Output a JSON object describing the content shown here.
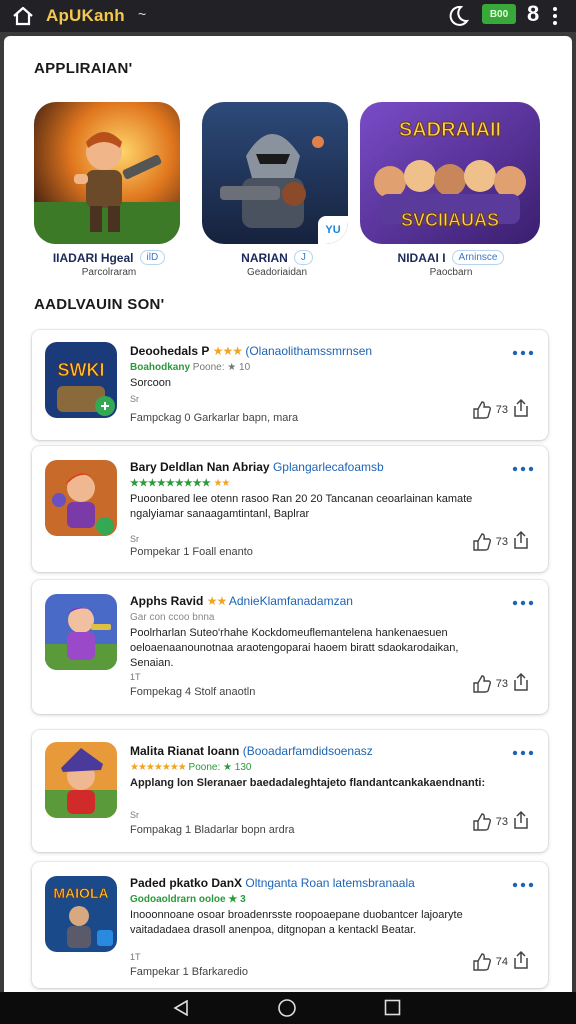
{
  "topbar": {
    "title": "ApUKanh",
    "title_suffix": "~",
    "battery_label": "B00",
    "count": "8",
    "icons": [
      "home-icon",
      "moon-icon",
      "more-vertical-icon"
    ]
  },
  "sections": {
    "featured_title": "APPLIRAIAN'",
    "list_title": "AADLVAUIN SON'"
  },
  "featured": [
    {
      "name": "IIADARI Hgeal",
      "chip": "ilD",
      "sub": "Parcolraram",
      "badge": ""
    },
    {
      "name": "NARIAN",
      "chip": "J",
      "sub": "Geadoriaidan",
      "badge": "YU"
    },
    {
      "name": "NIDAAI I",
      "chip": "Arninsce",
      "sub": "Paocbarn",
      "banner_top": "SADRAIAII",
      "banner_bottom": "SVCIIAUAS"
    }
  ],
  "apps": [
    {
      "icon_text": "SWKI",
      "title": "Deoohedals P",
      "stars": "★★★",
      "developer": "(Olanaolithamssmrnsen",
      "meta_green": "Boahodkany",
      "meta_rating": "Poone: ★ 10",
      "desc": "Sorcoon",
      "size": "Sr",
      "footer": "Fampckag 0 Garkarlar bapn, mara",
      "likes": "73"
    },
    {
      "icon_text": "",
      "title": "Bary Deldlan Nan Abriay",
      "stars": "",
      "developer": "Gplangarlecafoamsb",
      "meta_green": "★★★★★★★★★",
      "meta_rating": "★★",
      "desc": "Puoonbared lee otenn rasoo Ran 20 20 Tancanan ceoarlainan kamate ngalyiamar sanaagamtintanl, Baplrar",
      "size": "Sr",
      "footer": "Pompekar 1 Foall enanto",
      "likes": "73"
    },
    {
      "icon_text": "",
      "title": "Apphs Ravid",
      "stars": "★★",
      "developer": "AdnieKlamfanadamzan",
      "meta_green": "Gar con ccoo bnna",
      "meta_rating": "",
      "desc": "Poolrharlan Suteo'rhahe Kockdomeuflemantelena hankenaesuen oeloaenaanounotnaa araotengoparai haoem biratt sdaokarodaikan, Senaian.",
      "size": "1T",
      "footer": "Fompekag 4 Stolf anaotln",
      "likes": "73"
    },
    {
      "icon_text": "",
      "title": "Malita Rianat loann",
      "stars": "",
      "developer": "(Booadarfamdidsoenasz",
      "meta_green": "★★★★★★★",
      "meta_rating": "Poone: ★ 130",
      "desc": "Applang lon Sleranaer baedadaleghtajeto flandantcankakaendnanti:",
      "size": "Sr",
      "footer": "Fompakag 1 Bladarlar bopn ardra",
      "likes": "73"
    },
    {
      "icon_text": "MAIOLA",
      "title": "Paded pkatko DanX",
      "stars": "",
      "developer": "Oltnganta Roan latemsbranaala",
      "meta_green": "Godoaoldrarn ooloe ★ 3",
      "meta_rating": "",
      "desc": "Inooonnoane osoar broadenrsste roopoaepane duobantcer lajoaryte vaitadadaea drasoll anenpoa, ditgnopan a kentackl Beatar.",
      "size": "1T",
      "footer": "Fampekar 1 Bfarkaredio",
      "likes": "74"
    }
  ],
  "navbar": {
    "icons": [
      "back-icon",
      "home-circle-icon",
      "recents-icon"
    ]
  },
  "colors": {
    "accent": "#1d64b5",
    "star": "#f2a422",
    "green": "#2a9a3a",
    "title_gold": "#f4c84a"
  }
}
